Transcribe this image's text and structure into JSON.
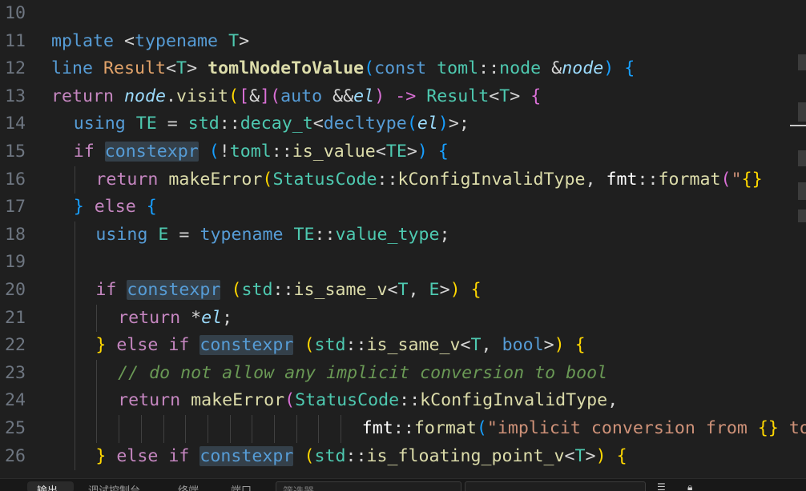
{
  "lines": [
    {
      "num": "10",
      "tokens": []
    },
    {
      "num": "11",
      "tokens": [
        {
          "t": "mplate ",
          "c": "t-kw"
        },
        {
          "t": "<",
          "c": "t-op"
        },
        {
          "t": "typename",
          "c": "t-kw"
        },
        {
          "t": " ",
          "c": "t-txt"
        },
        {
          "t": "T",
          "c": "t-type"
        },
        {
          "t": ">",
          "c": "t-op"
        }
      ]
    },
    {
      "num": "12",
      "tokens": [
        {
          "t": "line ",
          "c": "t-kw"
        },
        {
          "t": "Result",
          "c": "t-orng"
        },
        {
          "t": "<",
          "c": "t-op"
        },
        {
          "t": "T",
          "c": "t-type"
        },
        {
          "t": "> ",
          "c": "t-op"
        },
        {
          "t": "tomlNodeToValue",
          "c": "t-fnb"
        },
        {
          "t": "(",
          "c": "t-p3"
        },
        {
          "t": "const ",
          "c": "t-kw"
        },
        {
          "t": "toml",
          "c": "t-ns"
        },
        {
          "t": "::",
          "c": "t-op"
        },
        {
          "t": "node ",
          "c": "t-type"
        },
        {
          "t": "&",
          "c": "t-op"
        },
        {
          "t": "node",
          "c": "t-param"
        },
        {
          "t": ")",
          "c": "t-p3"
        },
        {
          "t": " {",
          "c": "t-p3"
        }
      ]
    },
    {
      "num": "13",
      "tokens": [
        {
          "t": "return ",
          "c": "t-ctl"
        },
        {
          "t": "node",
          "c": "t-param"
        },
        {
          "t": ".",
          "c": "t-op"
        },
        {
          "t": "visit",
          "c": "t-fn"
        },
        {
          "t": "(",
          "c": "t-p1"
        },
        {
          "t": "[",
          "c": "t-p2"
        },
        {
          "t": "&",
          "c": "t-op"
        },
        {
          "t": "]",
          "c": "t-p2"
        },
        {
          "t": "(",
          "c": "t-p2"
        },
        {
          "t": "auto ",
          "c": "t-kw"
        },
        {
          "t": "&&",
          "c": "t-op"
        },
        {
          "t": "el",
          "c": "t-param"
        },
        {
          "t": ") -> ",
          "c": "t-p2"
        },
        {
          "t": "Result",
          "c": "t-grn"
        },
        {
          "t": "<",
          "c": "t-op"
        },
        {
          "t": "T",
          "c": "t-type"
        },
        {
          "t": "> ",
          "c": "t-op"
        },
        {
          "t": "{",
          "c": "t-p2"
        }
      ]
    },
    {
      "num": "14",
      "indent": 1,
      "tokens": [
        {
          "t": "using ",
          "c": "t-kw"
        },
        {
          "t": "TE",
          "c": "t-type"
        },
        {
          "t": " = ",
          "c": "t-op"
        },
        {
          "t": "std",
          "c": "t-ns"
        },
        {
          "t": "::",
          "c": "t-op"
        },
        {
          "t": "decay_t",
          "c": "t-type"
        },
        {
          "t": "<",
          "c": "t-op"
        },
        {
          "t": "decltype",
          "c": "t-kw"
        },
        {
          "t": "(",
          "c": "t-p3"
        },
        {
          "t": "el",
          "c": "t-param"
        },
        {
          "t": ")",
          "c": "t-p3"
        },
        {
          "t": ">;",
          "c": "t-op"
        }
      ]
    },
    {
      "num": "15",
      "indent": 1,
      "tokens": [
        {
          "t": "if ",
          "c": "t-ctl"
        },
        {
          "t": "constexpr",
          "c": "t-kw t-hl"
        },
        {
          "t": " ",
          "c": "t-txt"
        },
        {
          "t": "(",
          "c": "t-p3"
        },
        {
          "t": "!",
          "c": "t-op"
        },
        {
          "t": "toml",
          "c": "t-ns"
        },
        {
          "t": "::",
          "c": "t-op"
        },
        {
          "t": "is_value",
          "c": "t-fn"
        },
        {
          "t": "<",
          "c": "t-op"
        },
        {
          "t": "TE",
          "c": "t-type"
        },
        {
          "t": ">",
          "c": "t-op"
        },
        {
          "t": ")",
          "c": "t-p3"
        },
        {
          "t": " {",
          "c": "t-p3"
        }
      ]
    },
    {
      "num": "16",
      "indent": 2,
      "tokens": [
        {
          "t": "return ",
          "c": "t-ctl"
        },
        {
          "t": "makeError",
          "c": "t-fn"
        },
        {
          "t": "(",
          "c": "t-p1"
        },
        {
          "t": "StatusCode",
          "c": "t-ns"
        },
        {
          "t": "::",
          "c": "t-op"
        },
        {
          "t": "kConfigInvalidType",
          "c": "t-fn"
        },
        {
          "t": ", ",
          "c": "t-op"
        },
        {
          "t": "fmt",
          "c": "t-plain"
        },
        {
          "t": "::",
          "c": "t-op"
        },
        {
          "t": "format",
          "c": "t-fn"
        },
        {
          "t": "(",
          "c": "t-p2"
        },
        {
          "t": "\"",
          "c": "t-str"
        },
        {
          "t": "{}",
          "c": "t-p1"
        }
      ]
    },
    {
      "num": "17",
      "indent": 1,
      "tokens": [
        {
          "t": "}",
          "c": "t-p3"
        },
        {
          "t": " else ",
          "c": "t-ctl"
        },
        {
          "t": "{",
          "c": "t-p3"
        }
      ]
    },
    {
      "num": "18",
      "indent": 2,
      "tokens": [
        {
          "t": "using ",
          "c": "t-kw"
        },
        {
          "t": "E",
          "c": "t-type"
        },
        {
          "t": " = ",
          "c": "t-op"
        },
        {
          "t": "typename ",
          "c": "t-kw"
        },
        {
          "t": "TE",
          "c": "t-type"
        },
        {
          "t": "::",
          "c": "t-op"
        },
        {
          "t": "value_type",
          "c": "t-type"
        },
        {
          "t": ";",
          "c": "t-op"
        }
      ]
    },
    {
      "num": "19",
      "indent": 2,
      "tokens": []
    },
    {
      "num": "20",
      "indent": 2,
      "tokens": [
        {
          "t": "if ",
          "c": "t-ctl"
        },
        {
          "t": "constexpr",
          "c": "t-kw t-hl"
        },
        {
          "t": " ",
          "c": "t-txt"
        },
        {
          "t": "(",
          "c": "t-p1"
        },
        {
          "t": "std",
          "c": "t-ns"
        },
        {
          "t": "::",
          "c": "t-op"
        },
        {
          "t": "is_same_v",
          "c": "t-fn"
        },
        {
          "t": "<",
          "c": "t-op"
        },
        {
          "t": "T",
          "c": "t-type"
        },
        {
          "t": ", ",
          "c": "t-op"
        },
        {
          "t": "E",
          "c": "t-type"
        },
        {
          "t": ">",
          "c": "t-op"
        },
        {
          "t": ")",
          "c": "t-p1"
        },
        {
          "t": " {",
          "c": "t-p1"
        }
      ]
    },
    {
      "num": "21",
      "indent": 3,
      "tokens": [
        {
          "t": "return ",
          "c": "t-ctl"
        },
        {
          "t": "*",
          "c": "t-op"
        },
        {
          "t": "el",
          "c": "t-param"
        },
        {
          "t": ";",
          "c": "t-op"
        }
      ]
    },
    {
      "num": "22",
      "indent": 2,
      "tokens": [
        {
          "t": "}",
          "c": "t-p1"
        },
        {
          "t": " else if ",
          "c": "t-ctl"
        },
        {
          "t": "constexpr",
          "c": "t-kw t-hl"
        },
        {
          "t": " ",
          "c": "t-txt"
        },
        {
          "t": "(",
          "c": "t-p1"
        },
        {
          "t": "std",
          "c": "t-ns"
        },
        {
          "t": "::",
          "c": "t-op"
        },
        {
          "t": "is_same_v",
          "c": "t-fn"
        },
        {
          "t": "<",
          "c": "t-op"
        },
        {
          "t": "T",
          "c": "t-type"
        },
        {
          "t": ", ",
          "c": "t-op"
        },
        {
          "t": "bool",
          "c": "t-kw"
        },
        {
          "t": ">",
          "c": "t-op"
        },
        {
          "t": ")",
          "c": "t-p1"
        },
        {
          "t": " {",
          "c": "t-p1"
        }
      ]
    },
    {
      "num": "23",
      "indent": 3,
      "tokens": [
        {
          "t": "// do not allow any implicit conversion to bool",
          "c": "t-cmt"
        }
      ]
    },
    {
      "num": "24",
      "indent": 3,
      "tokens": [
        {
          "t": "return ",
          "c": "t-ctl"
        },
        {
          "t": "makeError",
          "c": "t-fn"
        },
        {
          "t": "(",
          "c": "t-p2"
        },
        {
          "t": "StatusCode",
          "c": "t-ns"
        },
        {
          "t": "::",
          "c": "t-op"
        },
        {
          "t": "kConfigInvalidType",
          "c": "t-fn"
        },
        {
          "t": ",",
          "c": "t-op"
        }
      ]
    },
    {
      "num": "25",
      "indent": 3,
      "wrapIndent": 11,
      "tokens": [
        {
          "t": "fmt",
          "c": "t-plain"
        },
        {
          "t": "::",
          "c": "t-op"
        },
        {
          "t": "format",
          "c": "t-fn"
        },
        {
          "t": "(",
          "c": "t-p3"
        },
        {
          "t": "\"implicit conversion from ",
          "c": "t-str"
        },
        {
          "t": "{}",
          "c": "t-p1"
        },
        {
          "t": " to b",
          "c": "t-str"
        }
      ]
    },
    {
      "num": "26",
      "indent": 2,
      "tokens": [
        {
          "t": "}",
          "c": "t-p1"
        },
        {
          "t": " else if ",
          "c": "t-ctl"
        },
        {
          "t": "constexpr",
          "c": "t-kw t-hl"
        },
        {
          "t": " ",
          "c": "t-txt"
        },
        {
          "t": "(",
          "c": "t-p1"
        },
        {
          "t": "std",
          "c": "t-ns"
        },
        {
          "t": "::",
          "c": "t-op"
        },
        {
          "t": "is_floating_point_v",
          "c": "t-fn"
        },
        {
          "t": "<",
          "c": "t-op"
        },
        {
          "t": "T",
          "c": "t-type"
        },
        {
          "t": ">",
          "c": "t-op"
        },
        {
          "t": ")",
          "c": "t-p1"
        },
        {
          "t": " {",
          "c": "t-p1"
        }
      ]
    }
  ],
  "panel": {
    "tabs": [
      "输出",
      "调试控制台",
      "终端",
      "端口"
    ],
    "filter_placeholder": "筛选器"
  }
}
